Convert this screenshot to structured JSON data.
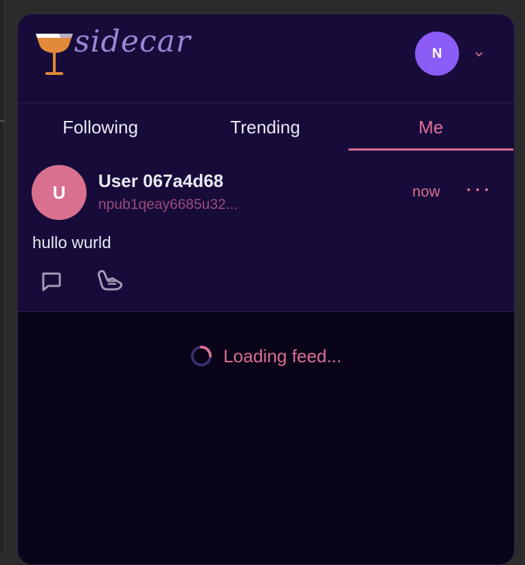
{
  "app": {
    "logo_text": "sidecar"
  },
  "account": {
    "avatar_initial": "N"
  },
  "tabs": [
    {
      "label": "Following"
    },
    {
      "label": "Trending"
    },
    {
      "label": "Me"
    }
  ],
  "active_tab": "Me",
  "post": {
    "avatar_initial": "U",
    "display_name": "User 067a4d68",
    "npub": "npub1qeay6685u32...",
    "time": "now",
    "content": "hullo wurld"
  },
  "feed": {
    "loading_text": "Loading feed..."
  },
  "colors": {
    "accent": "#e0709a",
    "header_bg": "#170c39",
    "feed_bg": "#0a0419",
    "account_avatar": "#8b5cf6",
    "post_avatar": "#d9708f"
  },
  "icons": [
    "cocktail-glass-icon",
    "chevron-down-icon",
    "more-options-icon",
    "reply-icon",
    "shaka-icon",
    "spinner-icon"
  ]
}
